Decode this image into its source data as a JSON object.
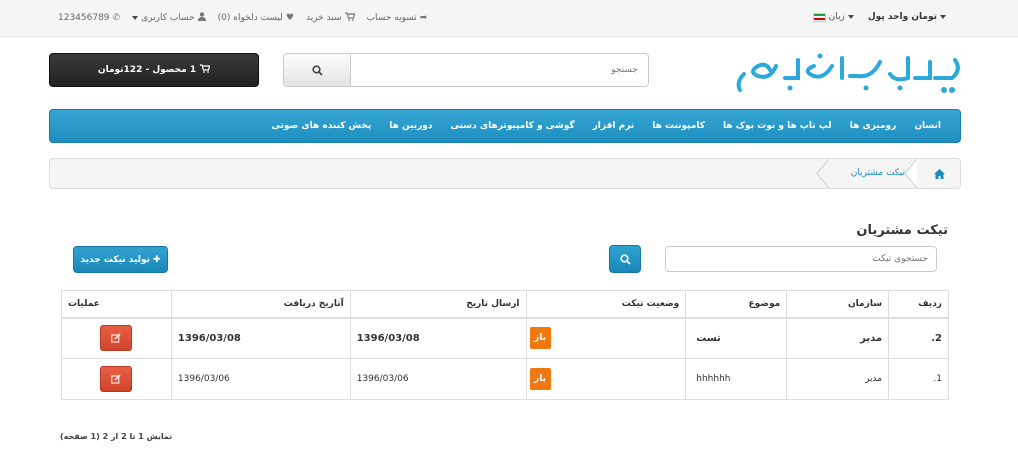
{
  "topbar": {
    "currency": "تومان واحد پول",
    "language": "زبان",
    "phone": "123456789",
    "account": "حساب کاربری",
    "wishlist": "لیست دلخواه (0)",
    "cart": "سبد خرید",
    "checkout": "تسویه حساب"
  },
  "header": {
    "search_placeholder": "جستجو",
    "cart_summary": "1 محصول - 122تومان"
  },
  "nav": {
    "items": [
      "انسان",
      "رومیزی ها",
      "لپ تاپ ها و نوت بوک ها",
      "کامپوننت ها",
      "نرم افزار",
      "گوشی و کامپیوترهای دستی",
      "دوربین ها",
      "پخش کننده های صوتی"
    ]
  },
  "breadcrumb": {
    "current": "تیکت مشتریان"
  },
  "page": {
    "title": "تیکت مشتریان",
    "search_placeholder": "جستجوی تیکت",
    "new_ticket": "تولید تیکت جدید"
  },
  "table": {
    "headers": {
      "row": "ردیف",
      "org": "سازمان",
      "subject": "موضوع",
      "status": "وضعیت تیکت",
      "sent": "ارسال تاریخ",
      "received": "آتاریخ دریافت",
      "ops": "عملیات"
    },
    "rows": [
      {
        "row": "2.",
        "org": "مدیر",
        "subject": "تست",
        "status": "باز",
        "sent": "1396/03/08",
        "received": "1396/03/08"
      },
      {
        "row": "1.",
        "org": "مدیر",
        "subject": "hhhhhh",
        "status": "باز",
        "sent": "1396/03/06",
        "received": "1396/03/06"
      }
    ]
  },
  "pager": {
    "info": "نمایش 1 تا 2 از 2 (1 صفحه)"
  },
  "colors": {
    "accent": "#1e8ec0",
    "status": "#f0780f",
    "danger": "#d9534f",
    "cart_bg": "#2a2a2a"
  }
}
